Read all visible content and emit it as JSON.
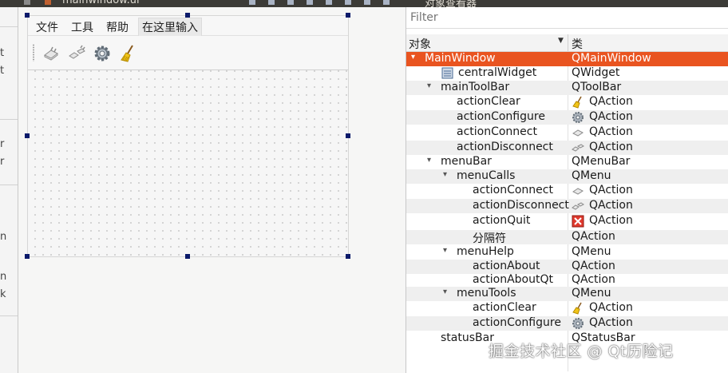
{
  "window": {
    "designer_title": "mainwindow.ui",
    "inspector_title": "对象查看器"
  },
  "form": {
    "menus": [
      "文件",
      "工具",
      "帮助"
    ],
    "menu_placeholder": "在这里输入",
    "toolbar_icons": [
      "connect-icon",
      "disconnect-icon",
      "gear-icon",
      "broom-icon"
    ]
  },
  "left_strip": {
    "chars": [
      "t",
      "t",
      "r",
      "r",
      "n",
      "n",
      "k"
    ]
  },
  "inspector": {
    "filter_placeholder": "Filter",
    "col_object": "对象",
    "col_class": "类",
    "rows": [
      {
        "name": "MainWindow",
        "cls": "QMainWindow",
        "arrow": "▾",
        "selected": true
      },
      {
        "name": "centralWidget",
        "cls": "QWidget",
        "name_icon": "widget-icon"
      },
      {
        "name": "mainToolBar",
        "cls": "QToolBar",
        "arrow": "▾"
      },
      {
        "name": "actionClear",
        "cls": "QAction",
        "icon": "broom-icon"
      },
      {
        "name": "actionConfigure",
        "cls": "QAction",
        "icon": "gear-icon"
      },
      {
        "name": "actionConnect",
        "cls": "QAction",
        "icon": "connect-icon"
      },
      {
        "name": "actionDisconnect",
        "cls": "QAction",
        "icon": "disconnect-icon"
      },
      {
        "name": "menuBar",
        "cls": "QMenuBar",
        "arrow": "▾"
      },
      {
        "name": "menuCalls",
        "cls": "QMenu",
        "arrow": "▾"
      },
      {
        "name": "actionConnect",
        "cls": "QAction",
        "icon": "connect-icon"
      },
      {
        "name": "actionDisconnect",
        "cls": "QAction",
        "icon": "disconnect-icon"
      },
      {
        "name": "actionQuit",
        "cls": "QAction",
        "icon": "quit-icon"
      },
      {
        "name": "分隔符",
        "cls": "QAction"
      },
      {
        "name": "menuHelp",
        "cls": "QMenu",
        "arrow": "▾"
      },
      {
        "name": "actionAbout",
        "cls": "QAction"
      },
      {
        "name": "actionAboutQt",
        "cls": "QAction"
      },
      {
        "name": "menuTools",
        "cls": "QMenu",
        "arrow": "▾"
      },
      {
        "name": "actionClear",
        "cls": "QAction",
        "icon": "broom-icon"
      },
      {
        "name": "actionConfigure",
        "cls": "QAction",
        "icon": "gear-icon"
      },
      {
        "name": "statusBar",
        "cls": "QStatusBar"
      }
    ]
  },
  "watermark": "掘金技术社区 @ Qt历险记",
  "colors": {
    "selection": "#e95420",
    "handle": "#0b1a6a"
  }
}
